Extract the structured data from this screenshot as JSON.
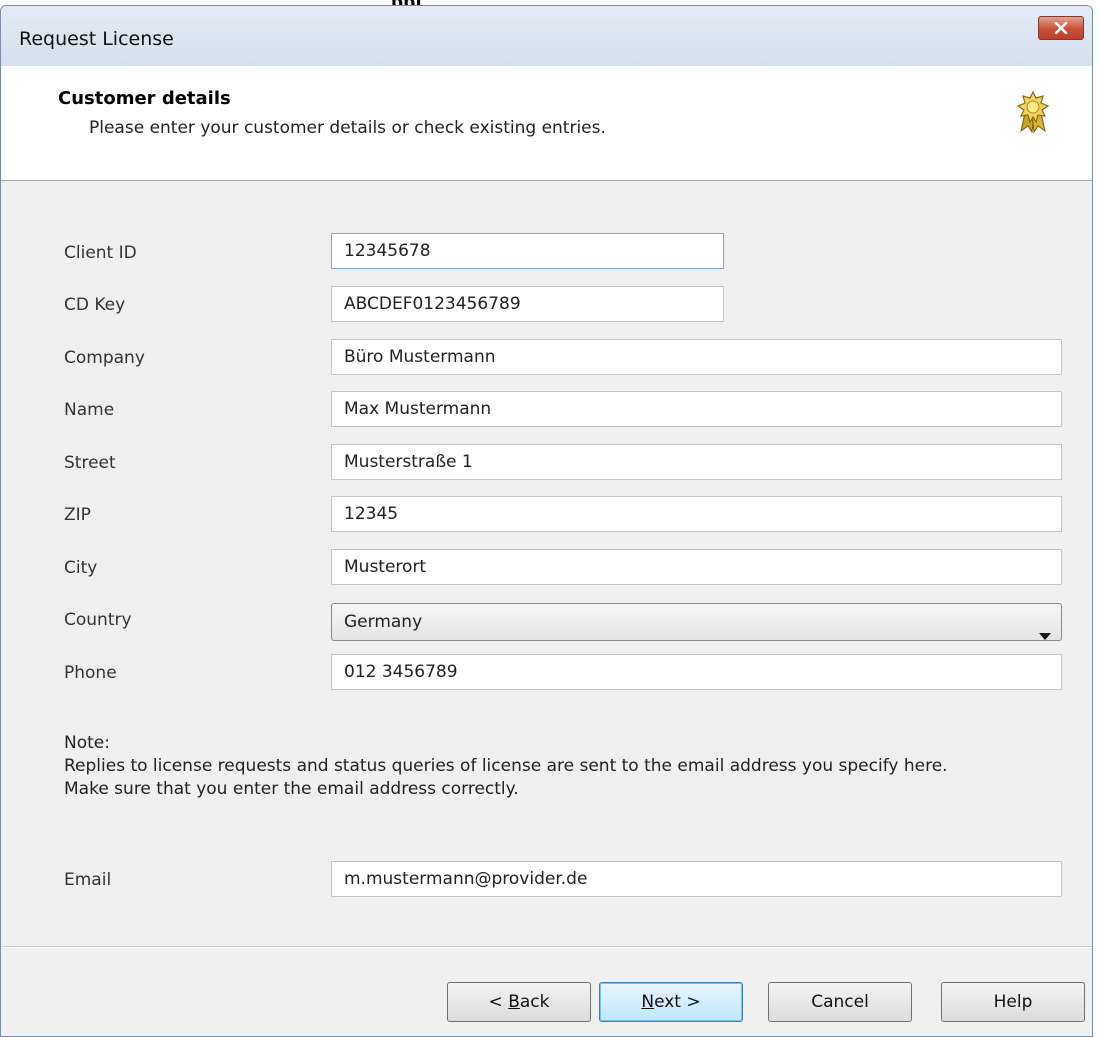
{
  "doc_fragment": "ppl",
  "window": {
    "title": "Request License",
    "close_icon": "close-x-icon"
  },
  "header": {
    "title": "Customer details",
    "subtitle": "Please enter your customer details or check existing entries.",
    "icon": "certificate-ribbon-icon"
  },
  "form": {
    "client_id": {
      "label": "Client ID",
      "value": "12345678"
    },
    "cd_key": {
      "label": "CD Key",
      "value": "ABCDEF0123456789"
    },
    "company": {
      "label": "Company",
      "value": "Büro Mustermann"
    },
    "name": {
      "label": "Name",
      "value": "Max Mustermann"
    },
    "street": {
      "label": "Street",
      "value": "Musterstraße 1"
    },
    "zip": {
      "label": "ZIP",
      "value": "12345"
    },
    "city": {
      "label": "City",
      "value": "Musterort"
    },
    "country": {
      "label": "Country",
      "value": "Germany"
    },
    "phone": {
      "label": "Phone",
      "value": "012 3456789"
    },
    "email": {
      "label": "Email",
      "value": "m.mustermann@provider.de"
    }
  },
  "note": {
    "heading": "Note:",
    "line1": "Replies to license requests and status queries of license are sent to the email address you specify here.",
    "line2": "Make sure that you enter the email address correctly."
  },
  "buttons": {
    "back": {
      "prefix": "< ",
      "accel": "B",
      "rest": "ack"
    },
    "next": {
      "accel": "N",
      "rest": "ext >"
    },
    "cancel": "Cancel",
    "help": "Help"
  },
  "colors": {
    "title_bar": "#dbe6f2",
    "close_button": "#c7503a",
    "default_button": "#bee6fd",
    "dialog_bg": "#f0f0f0"
  }
}
